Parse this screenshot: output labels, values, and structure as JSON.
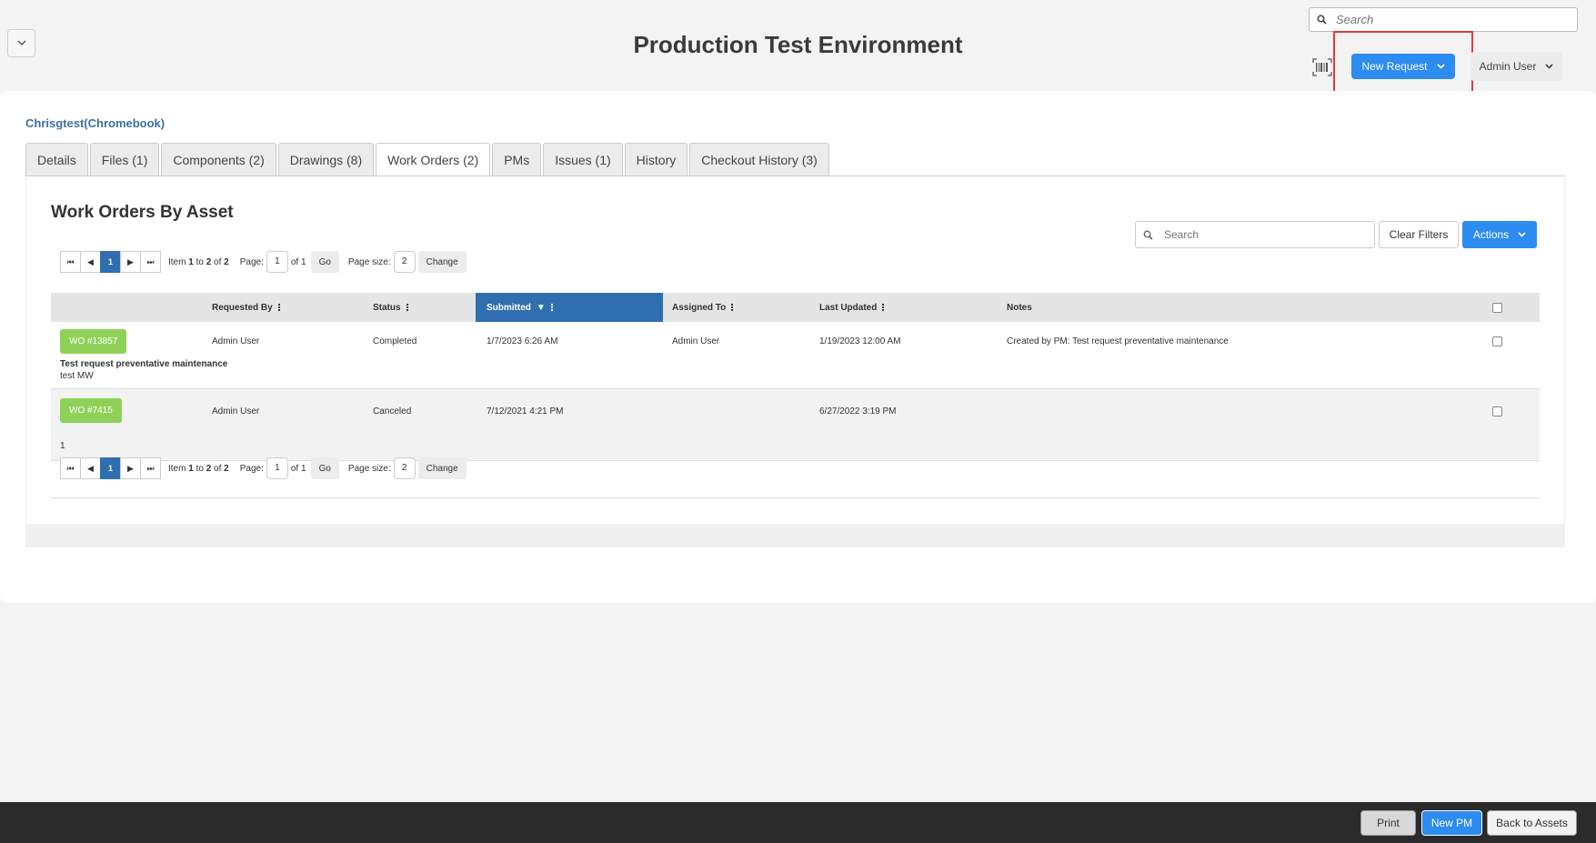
{
  "header": {
    "title": "Production Test Environment",
    "search_placeholder": "Search",
    "new_request_label": "New Request",
    "user_label": "Admin User"
  },
  "asset": {
    "name": "Chrisgtest(Chromebook)"
  },
  "tabs": [
    {
      "label": "Details"
    },
    {
      "label": "Files (1)"
    },
    {
      "label": "Components (2)"
    },
    {
      "label": "Drawings (8)"
    },
    {
      "label": "Work Orders (2)"
    },
    {
      "label": "PMs"
    },
    {
      "label": "Issues (1)"
    },
    {
      "label": "History"
    },
    {
      "label": "Checkout History (3)"
    }
  ],
  "work_orders": {
    "title": "Work Orders By Asset",
    "search_placeholder": "Search",
    "clear_filters_label": "Clear Filters",
    "actions_label": "Actions",
    "pager": {
      "current_page": "1",
      "item_prefix": "Item",
      "item_from": "1",
      "item_to_word": "to",
      "item_to": "2",
      "item_of_word": "of",
      "item_total": "2",
      "page_label": "Page:",
      "page_value": "1",
      "page_of": "of 1",
      "go_label": "Go",
      "page_size_label": "Page size:",
      "page_size_value": "2",
      "change_label": "Change"
    },
    "columns": {
      "requested_by": "Requested By",
      "status": "Status",
      "submitted": "Submitted",
      "assigned_to": "Assigned To",
      "last_updated": "Last Updated",
      "notes": "Notes"
    },
    "rows": [
      {
        "wo": "WO #13857",
        "requested_by": "Admin User",
        "status": "Completed",
        "submitted": "1/7/2023 6:26 AM",
        "assigned_to": "Admin User",
        "last_updated": "1/19/2023 12:00 AM",
        "notes": "Created by PM: Test request preventative maintenance",
        "desc_title": "Test request preventative maintenance",
        "desc_body": "test MW"
      },
      {
        "wo": "WO #7415",
        "requested_by": "Admin User",
        "status": "Canceled",
        "submitted": "7/12/2021 4:21 PM",
        "assigned_to": "",
        "last_updated": "6/27/2022 3:19 PM",
        "notes": "",
        "desc_title": "",
        "desc_body": "1"
      }
    ]
  },
  "footer": {
    "print_label": "Print",
    "new_pm_label": "New PM",
    "back_label": "Back to Assets"
  },
  "colors": {
    "accent": "#2d8cf0",
    "sorted_header": "#2f6fb0",
    "wo_badge": "#8fd158",
    "highlight": "#e53935",
    "footer": "#2b2b2b"
  }
}
